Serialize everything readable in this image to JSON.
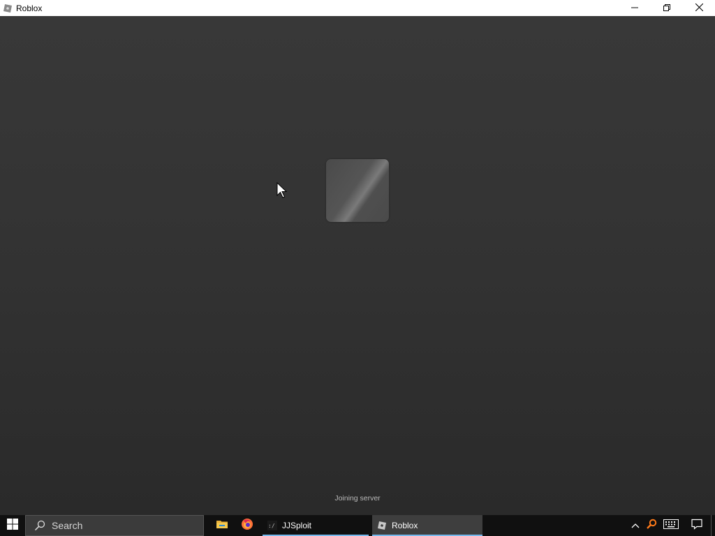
{
  "window": {
    "title": "Roblox",
    "icons": {
      "app": "roblox-logo-icon",
      "minimize": "minimize-icon",
      "restore": "restore-icon",
      "close": "close-icon"
    }
  },
  "loading": {
    "status": "Joining server",
    "tile": "roblox-loading-tile"
  },
  "taskbar": {
    "start_icon": "windows-logo-icon",
    "search": {
      "label": "Search",
      "icon": "search-icon"
    },
    "pinned": [
      {
        "icon": "file-explorer-icon"
      },
      {
        "icon": "firefox-icon"
      }
    ],
    "apps": [
      {
        "label": "JJSploit",
        "icon": "jjsploit-icon",
        "active": false
      },
      {
        "label": "Roblox",
        "icon": "roblox-logo-icon",
        "active": true
      }
    ],
    "tray": {
      "icons": [
        "chevron-up-icon",
        "magnifier-tray-icon",
        "keyboard-icon",
        "action-center-icon"
      ]
    }
  },
  "colors": {
    "accent_underline": "#76b9ed",
    "taskbar_bg": "#101010",
    "viewport_bg": "#333333"
  }
}
